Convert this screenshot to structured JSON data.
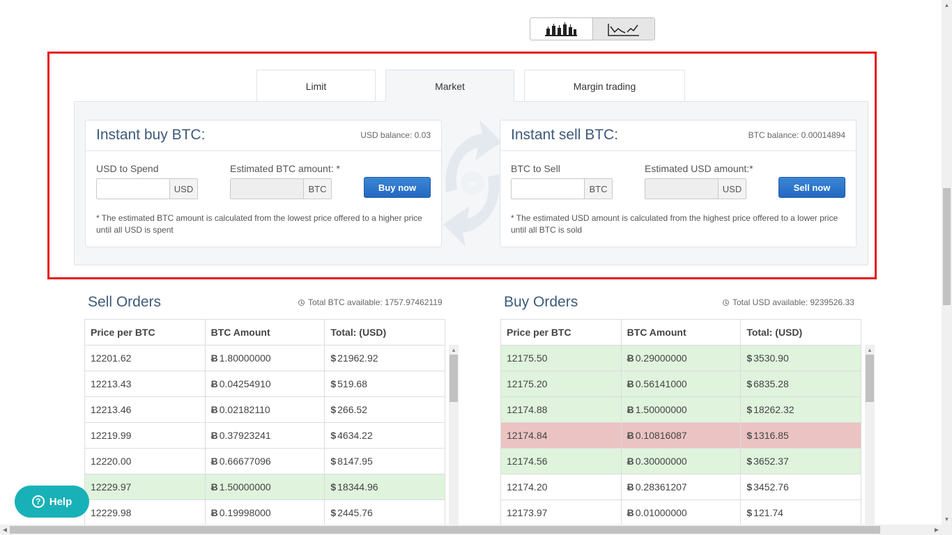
{
  "chart_toggle": {
    "candles_icon": "candlestick-chart-icon",
    "line_icon": "line-chart-icon"
  },
  "tabs": [
    {
      "label": "Limit"
    },
    {
      "label": "Market"
    },
    {
      "label": "Margin trading"
    }
  ],
  "buy": {
    "title": "Instant buy BTC:",
    "balance": "USD balance: 0.03",
    "spend_label": "USD to Spend",
    "spend_value": "",
    "spend_unit": "USD",
    "estimate_label": "Estimated BTC amount: *",
    "estimate_unit": "BTC",
    "button": "Buy now",
    "note": "* The estimated BTC amount is calculated from the lowest price offered to a higher price until all USD is spent"
  },
  "or_label": "or",
  "sell": {
    "title": "Instant sell BTC:",
    "balance": "BTC balance: 0.00014894",
    "spend_label": "BTC to Sell",
    "spend_value": "",
    "spend_unit": "BTC",
    "estimate_label": "Estimated USD amount:*",
    "estimate_unit": "USD",
    "button": "Sell now",
    "note": "* The estimated USD amount is calculated from the highest price offered to a lower price until all BTC is sold"
  },
  "sell_orders": {
    "title": "Sell Orders",
    "total": "Total BTC available: 1757.97462119",
    "columns": [
      "Price per BTC",
      "BTC Amount",
      "Total: (USD)"
    ],
    "rows": [
      {
        "price": "12201.62",
        "amount": "1.80000000",
        "total": "21962.92",
        "highlight": ""
      },
      {
        "price": "12213.43",
        "amount": "0.04254910",
        "total": "519.68",
        "highlight": ""
      },
      {
        "price": "12213.46",
        "amount": "0.02182110",
        "total": "266.52",
        "highlight": ""
      },
      {
        "price": "12219.99",
        "amount": "0.37923241",
        "total": "4634.22",
        "highlight": ""
      },
      {
        "price": "12220.00",
        "amount": "0.66677096",
        "total": "8147.95",
        "highlight": ""
      },
      {
        "price": "12229.97",
        "amount": "1.50000000",
        "total": "18344.96",
        "highlight": "green"
      },
      {
        "price": "12229.98",
        "amount": "0.19998000",
        "total": "2445.76",
        "highlight": ""
      }
    ]
  },
  "buy_orders": {
    "title": "Buy Orders",
    "total": "Total USD available: 9239526.33",
    "columns": [
      "Price per BTC",
      "BTC Amount",
      "Total: (USD)"
    ],
    "rows": [
      {
        "price": "12175.50",
        "amount": "0.29000000",
        "total": "3530.90",
        "highlight": "green"
      },
      {
        "price": "12175.20",
        "amount": "0.56141000",
        "total": "6835.28",
        "highlight": "green"
      },
      {
        "price": "12174.88",
        "amount": "1.50000000",
        "total": "18262.32",
        "highlight": "green"
      },
      {
        "price": "12174.84",
        "amount": "0.10816087",
        "total": "1316.85",
        "highlight": "red"
      },
      {
        "price": "12174.56",
        "amount": "0.30000000",
        "total": "3652.37",
        "highlight": "green"
      },
      {
        "price": "12174.20",
        "amount": "0.28361207",
        "total": "3452.76",
        "highlight": ""
      },
      {
        "price": "12173.97",
        "amount": "0.01000000",
        "total": "121.74",
        "highlight": ""
      }
    ]
  },
  "currency_symbols": {
    "btc": "Ƀ",
    "usd": "$"
  },
  "help": {
    "label": "Help",
    "icon": "question-icon"
  },
  "colors": {
    "highlight_frame": "#e8131b",
    "buy_button": "#2a72c9",
    "help_button": "#19b1b8",
    "row_green": "#dff3dd",
    "row_red": "#ebc3c3",
    "title": "#3d5a7a"
  }
}
